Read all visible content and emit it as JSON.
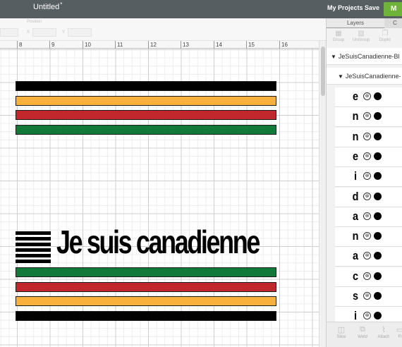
{
  "topbar": {
    "title": "Untitled",
    "unsaved_mark": "*",
    "my_projects": "My Projects",
    "save": "Save",
    "make_it": "M"
  },
  "toolbar": {
    "position_label": "Position",
    "x_label": "X",
    "y_label": "Y"
  },
  "ruler": {
    "numbers": [
      "8",
      "9",
      "10",
      "11",
      "12",
      "13",
      "14",
      "15",
      "16"
    ]
  },
  "canvas": {
    "slogan": "Je suis canadienne",
    "stripe_colors_top": [
      "#000000",
      "#f9b13c",
      "#c1272d",
      "#117a3b"
    ],
    "stripe_colors_bottom": [
      "#117a3b",
      "#c1272d",
      "#f9b13c",
      "#000000"
    ]
  },
  "panel": {
    "tabs": [
      "Layers",
      "C"
    ],
    "tools": [
      "Group",
      "UnGroup",
      "Duplic"
    ],
    "group_name": "JeSuisCanadienne-Bl",
    "subgroup_name": "JeSuisCanadienne-",
    "layers": [
      {
        "letter": "e",
        "hide_icon": "⊗",
        "color": "#000000"
      },
      {
        "letter": "n",
        "hide_icon": "⊗",
        "color": "#000000"
      },
      {
        "letter": "n",
        "hide_icon": "⊗",
        "color": "#000000"
      },
      {
        "letter": "e",
        "hide_icon": "⊗",
        "color": "#000000"
      },
      {
        "letter": "i",
        "hide_icon": "⊗",
        "color": "#000000"
      },
      {
        "letter": "d",
        "hide_icon": "⊗",
        "color": "#000000"
      },
      {
        "letter": "a",
        "hide_icon": "⊗",
        "color": "#000000"
      },
      {
        "letter": "n",
        "hide_icon": "⊗",
        "color": "#000000"
      },
      {
        "letter": "a",
        "hide_icon": "⊗",
        "color": "#000000"
      },
      {
        "letter": "c",
        "hide_icon": "⊗",
        "color": "#000000"
      },
      {
        "letter": "s",
        "hide_icon": "⊗",
        "color": "#000000"
      },
      {
        "letter": "i",
        "hide_icon": "⊗",
        "color": "#000000"
      }
    ],
    "bottom_tools": [
      "Slice",
      "Weld",
      "Attach",
      "Fl"
    ]
  }
}
